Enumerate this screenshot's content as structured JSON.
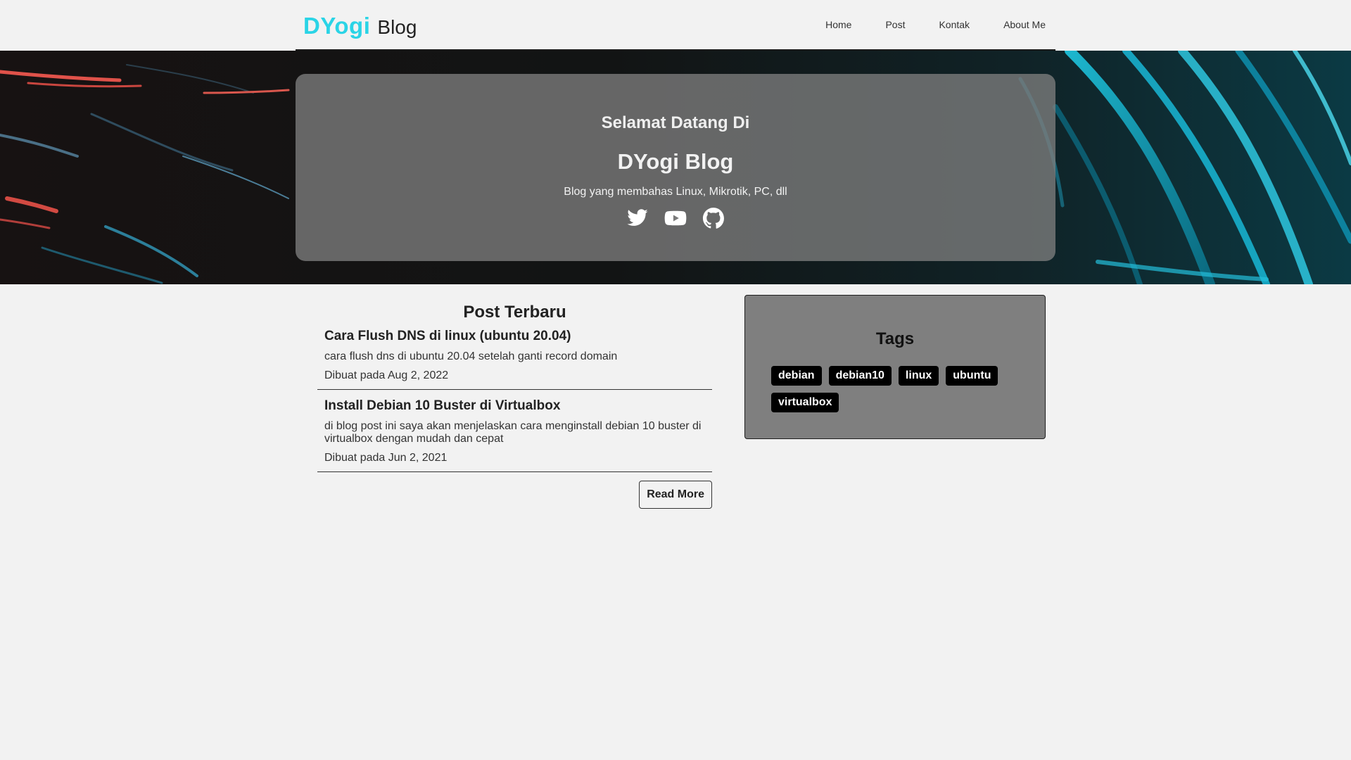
{
  "header": {
    "brand_accent": "DYogi",
    "brand_rest": "Blog",
    "nav": [
      {
        "label": "Home"
      },
      {
        "label": "Post"
      },
      {
        "label": "Kontak"
      },
      {
        "label": "About Me"
      }
    ]
  },
  "hero": {
    "greeting": "Selamat Datang Di",
    "title": "DYogi Blog",
    "subtitle": "Blog yang membahas Linux, Mikrotik, PC, dll",
    "social_icons": [
      "twitter-icon",
      "youtube-icon",
      "github-icon"
    ]
  },
  "posts": {
    "heading": "Post Terbaru",
    "items": [
      {
        "title": "Cara Flush DNS di linux (ubuntu 20.04)",
        "excerpt": "cara flush dns di ubuntu 20.04 setelah ganti record domain",
        "date": "Dibuat pada Aug 2, 2022"
      },
      {
        "title": "Install Debian 10 Buster di Virtualbox",
        "excerpt": "di blog post ini saya akan menjelaskan cara menginstall debian 10 buster di virtualbox dengan mudah dan cepat",
        "date": "Dibuat pada Jun 2, 2021"
      }
    ],
    "read_more_label": "Read More"
  },
  "tags": {
    "heading": "Tags",
    "items": [
      "debian",
      "debian10",
      "linux",
      "ubuntu",
      "virtualbox"
    ]
  },
  "colors": {
    "brand_accent": "#2ad4e6",
    "page_background": "#f2f2f2",
    "tags_panel": "#7f7f7f",
    "tag_background": "#000000"
  }
}
